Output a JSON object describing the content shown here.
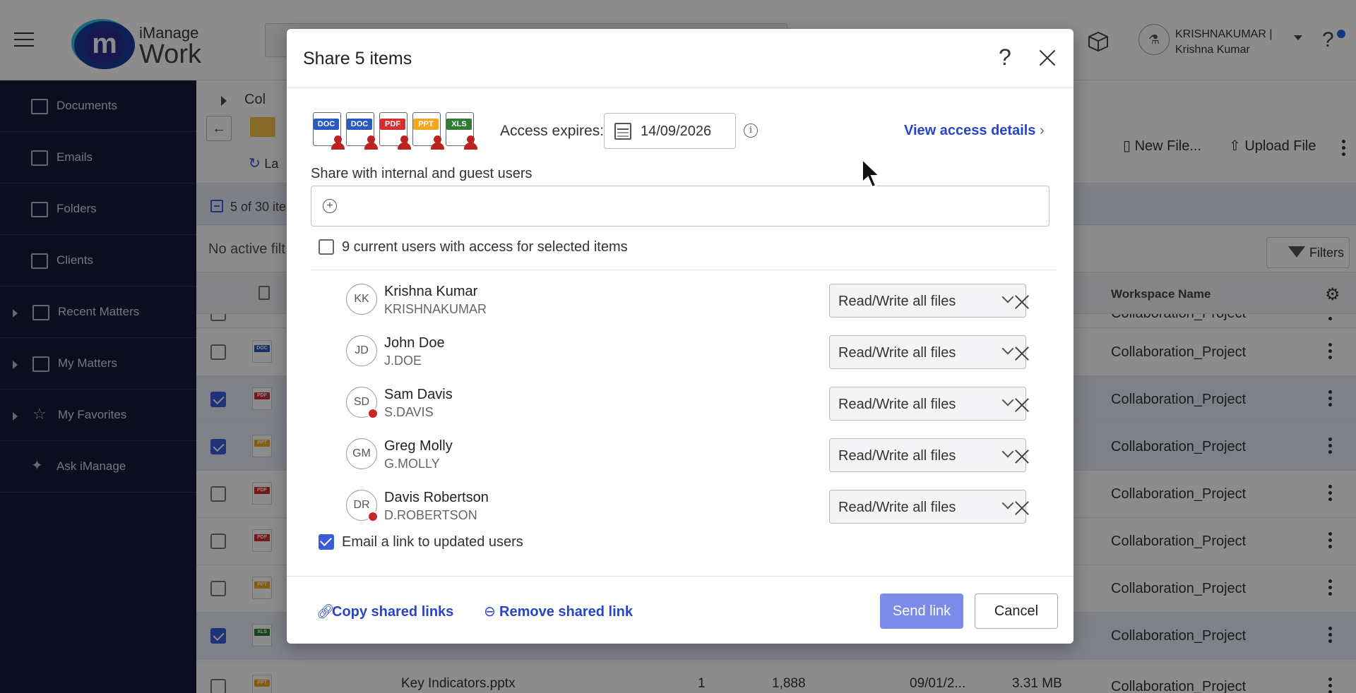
{
  "app": {
    "logo_top": "iManage",
    "logo_bottom": "Work",
    "logo_letter": "m",
    "user_avatar": "⚗",
    "user_name_line1": "KRISHNAKUMAR |",
    "user_name_line2": "Krishna Kumar"
  },
  "sidebar": {
    "items": [
      {
        "label": "Documents",
        "icon": "document-icon"
      },
      {
        "label": "Emails",
        "icon": "email-icon"
      },
      {
        "label": "Folders",
        "icon": "folder-icon"
      },
      {
        "label": "Clients",
        "icon": "briefcase-icon"
      },
      {
        "label": "Recent Matters",
        "icon": "recent-matters-icon"
      },
      {
        "label": "My Matters",
        "icon": "matters-icon"
      },
      {
        "label": "My Favorites",
        "icon": "star-icon"
      },
      {
        "label": "Ask iManage",
        "icon": "sparkle-icon"
      }
    ]
  },
  "main": {
    "breadcrumb": "Col",
    "refresh_label": "La",
    "new_file": "New File...",
    "upload_file": "Upload File",
    "selection_text": "5 of 30 ite",
    "filter_text": "No active filt",
    "filters_button": "Filters",
    "workspace_col": "Workspace Name",
    "rows": [
      {
        "type": "DOC",
        "color": "#2b59c3",
        "selected": false,
        "ws": "Collaboration_Project"
      },
      {
        "type": "PDF",
        "color": "#d32f2f",
        "selected": true,
        "ws": "Collaboration_Project"
      },
      {
        "type": "PPT",
        "color": "#f5a623",
        "selected": true,
        "ws": "Collaboration_Project"
      },
      {
        "type": "PDF",
        "color": "#d32f2f",
        "selected": false,
        "ws": "Collaboration_Project"
      },
      {
        "type": "PDF",
        "color": "#d32f2f",
        "selected": false,
        "ws": "Collaboration_Project"
      },
      {
        "type": "PPT",
        "color": "#f5a623",
        "selected": false,
        "ws": "Collaboration_Project"
      },
      {
        "type": "XLS",
        "color": "#2e7d32",
        "selected": true,
        "ws": "Collaboration_Project"
      }
    ],
    "last_row": {
      "name": "Key Indicators.pptx",
      "c1": "1",
      "c2": "1,888",
      "c3": "09/01/2...",
      "c4": "3.31 MB",
      "ws": "Collaboration_Project"
    },
    "top_row_ws": "Collaboration_Project"
  },
  "modal": {
    "title": "Share 5 items",
    "help": "?",
    "file_types": [
      {
        "label": "DOC",
        "color": "#2b59c3"
      },
      {
        "label": "DOC",
        "color": "#2b59c3"
      },
      {
        "label": "PDF",
        "color": "#d32f2f"
      },
      {
        "label": "PPT",
        "color": "#f5a623"
      },
      {
        "label": "XLS",
        "color": "#2e7d32"
      }
    ],
    "access_label": "Access expires:",
    "access_date": "14/09/2026",
    "info_glyph": "i",
    "view_access": "View access details",
    "share_label": "Share with internal and guest users",
    "plus_glyph": "+",
    "current_users": "9 current users with access for selected items",
    "users": [
      {
        "initials": "KK",
        "name": "Krishna Kumar",
        "login": "KRISHNAKUMAR",
        "perm": "Read/Write all files",
        "external": false
      },
      {
        "initials": "JD",
        "name": "John Doe",
        "login": "J.DOE",
        "perm": "Read/Write all files",
        "external": false
      },
      {
        "initials": "SD",
        "name": "Sam Davis",
        "login": "S.DAVIS",
        "perm": "Read/Write all files",
        "external": true
      },
      {
        "initials": "GM",
        "name": "Greg Molly",
        "login": "G.MOLLY",
        "perm": "Read/Write all files",
        "external": false
      },
      {
        "initials": "DR",
        "name": "Davis Robertson",
        "login": "D.ROBERTSON",
        "perm": "Read/Write all files",
        "external": true
      }
    ],
    "email_label": "Email a link to updated users",
    "copy_links": "Copy shared links",
    "remove_link": "Remove shared link",
    "send_link": "Send link",
    "cancel": "Cancel"
  }
}
